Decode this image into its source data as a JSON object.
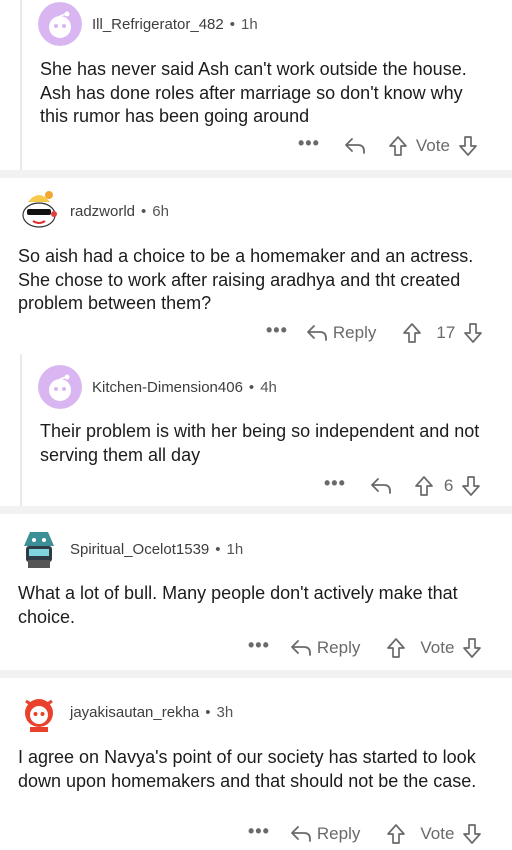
{
  "comments": [
    {
      "username": "Ill_Refrigerator_482",
      "time": "1h",
      "body": "She has never said Ash can't work outside the house. Ash has done roles after marriage so don't know why this rumor has been going around",
      "more": "•••",
      "reply_label": "",
      "vote_label": "Vote"
    },
    {
      "username": "radzworld",
      "time": "6h",
      "body": "So aish had a choice to be a homemaker and an actress. She chose to work after raising aradhya and tht created problem between them?",
      "more": "•••",
      "reply_label": "Reply",
      "vote_label": "17"
    },
    {
      "username": "Kitchen-Dimension406",
      "time": "4h",
      "body": "Their problem is with her being so independent and not serving them all day",
      "more": "•••",
      "reply_label": "",
      "vote_label": "6"
    },
    {
      "username": "Spiritual_Ocelot1539",
      "time": "1h",
      "body": "What a lot of bull. Many people don't actively make that choice.",
      "more": "•••",
      "reply_label": "Reply",
      "vote_label": "Vote"
    },
    {
      "username": "jayakisautan_rekha",
      "time": "3h",
      "body": "I agree on Navya's point of our society has started to look down upon homemakers and that should not be the case.",
      "more": "•••",
      "reply_label": "Reply",
      "vote_label": "Vote"
    }
  ],
  "separator": "•",
  "colors": {
    "avatar_purple": "#d9b6f2",
    "separator_bg": "#f2f2f2",
    "meta_text": "#6a6a6c"
  }
}
